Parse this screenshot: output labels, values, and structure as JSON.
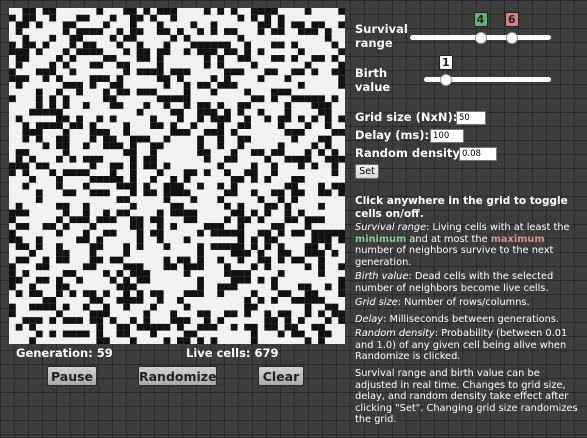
{
  "grid": {
    "size": 50,
    "cells": [
      "00110110000001000110101110000101010011110000100001",
      "10110010001100010011010010000000001010101000000000",
      "01101000110000100010001000010010000001101011011001",
      "01000000101111001011001101001010110001011001110100",
      "00100010011000010110000010100000001000000000000100",
      "10110100010110001001000100011111100100011010000010",
      "11101000101111000101101100101110110101000001000001",
      "01100001010000110001101000000101001100011010011010",
      "01000010100011001100001000000101000010000000100001",
      "10001110010000000101111011100000111000110011010011",
      "11100101000011101000001101000010100001000100000001",
      "01000000111010011000000100101101110000000001000001",
      "00001001001000101101110000100010000100011100000000",
      "10001010100000110000001111100000000011010011111010",
      "00001010100100011000100100101101001100000100011100",
      "00011111000000000001000011001110101001000100001100",
      "01000001101001010000010001001011100100101101010101",
      "00101111011010000100011010010001001100001000100100",
      "00111000100011100100000011100111010000000111000011",
      "00101001100010110011100100001001001100000010001100",
      "00000101100100111010011000001001001000001000010100",
      "01100000100000000110010000001100010011011000101010",
      "01010001010111000010110000000100110000100111100111",
      "11101100000010011010110100000001000010010001010010",
      "10100010111100010010001000110100100110010000000010",
      "00010001000011111010010010100000011010100011000000",
      "00100001000100001110100111001001010000000110001011",
      "00001000110011100010110111100000110010011011001101",
      "00001000000000001100000100010001000001001010000000",
      "01000001100100000010000011000000101000110100001000",
      "11100000100100101100001011110000011010100101000000",
      "10000001011101110011011000110000101101000110111000",
      "01100110100010000011001010000111001000011000100000",
      "10000001000100110001011000001011111001101011011111",
      "11001000001101000001001000100000001010110000011101",
      "01101001000011000101000100001011111010101000110100",
      "00010001100010000100000000001000011101001100111010",
      "01100101100011011000000101101001001001101011001000",
      "10001100000110000111000110111000100010100000101001",
      "10100000110000101011100000100000111100001000001000",
      "11001101001000010101100000001000011101010000000001",
      "10010001100000001110000000001001110000010001100101",
      "01011001010110100101011000111001000010001100110001",
      "00000110000011001111001001000000000101010011111000",
      "10011110100100100100010000100000000110000000100110",
      "10000001000011100000100010001100110100101100101011",
      "00111010111011010010100011100101000000110101000101",
      "01010000000001001101111101001110010110110110011000",
      "00001010111101001100010000110000000010001011001100",
      "00010000000001100010000101101010000010000000101000"
    ]
  },
  "status": {
    "generation_text": "Generation: 59",
    "live_text": "Live cells: 679"
  },
  "buttons": {
    "pause": "Pause",
    "randomize": "Randomize",
    "clear": "Clear",
    "set": "Set"
  },
  "survival": {
    "label_line1": "Survival",
    "label_line2": "range",
    "min": 4,
    "max": 6,
    "range_min": 0,
    "range_max": 8,
    "min_color": "#5fb56f",
    "max_color": "#d98080"
  },
  "birth": {
    "label_line1": "Birth",
    "label_line2": "value",
    "value": 1,
    "range_min": 0,
    "range_max": 8
  },
  "fields": {
    "grid_size_label": "Grid size (NxN):",
    "grid_size_value": "50",
    "delay_label": "Delay (ms):",
    "delay_value": "100",
    "density_label": "Random density:",
    "density_value": "0.08"
  },
  "info": {
    "title": "Click anywhere in the grid to toggle cells on/off.",
    "survival_term": "Survival range",
    "survival_text_1": ": Living cells with at least the ",
    "survival_min_word": "minimum",
    "survival_text_2": " and at most the ",
    "survival_max_word": "maximum",
    "survival_text_3": " number of neighbors survive to the next generation.",
    "birth_term": "Birth value",
    "birth_text": ": Dead cells with the selected number of neighbors become live cells.",
    "grid_term": "Grid size",
    "grid_text": ": Number of rows/columns.",
    "delay_term": "Delay",
    "delay_text": ": Milliseconds between generations.",
    "density_term": "Random density",
    "density_text": ": Probability (between 0.01 and 1.0) of any given cell being alive when Randomize is clicked.",
    "footer": "Survival range and birth value can be adjusted in real time. Changes to grid size, delay, and random density take effect after clicking \"Set\". Changing grid size randomizes the grid."
  }
}
